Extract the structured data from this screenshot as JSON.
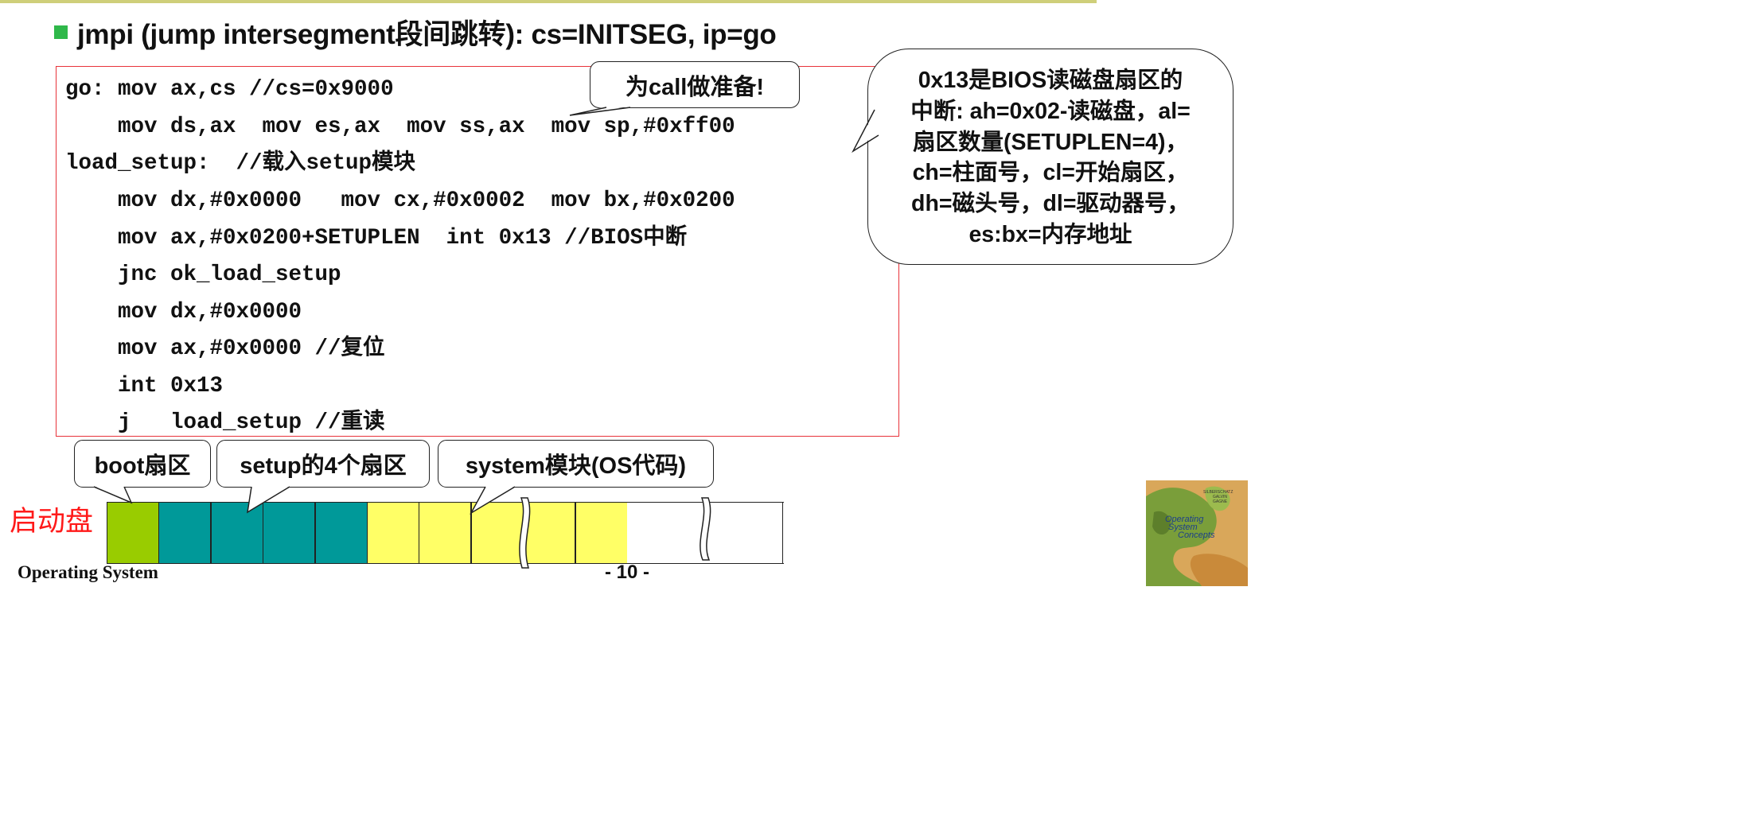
{
  "colors": {
    "accent_rule": "#cfcf7a",
    "bullet": "#2fb84a",
    "code_border": "#e8333a",
    "disk_label": "#ff1a1a",
    "boot_sector": "#99cc00",
    "setup_sector": "#009999",
    "system_sector": "#ffff66",
    "free_sector": "#ffffff"
  },
  "title": "jmpi (jump intersegment段间跳转): cs=INITSEG, ip=go",
  "code_lines": [
    "go: mov ax,cs //cs=0x9000",
    "    mov ds,ax  mov es,ax  mov ss,ax  mov sp,#0xff00",
    "load_setup:  //载入setup模块",
    "    mov dx,#0x0000   mov cx,#0x0002  mov bx,#0x0200",
    "    mov ax,#0x0200+SETUPLEN  int 0x13 //BIOS中断",
    "    jnc ok_load_setup",
    "    mov dx,#0x0000",
    "    mov ax,#0x0000 //复位",
    "    int 0x13",
    "    j   load_setup //重读"
  ],
  "callouts": {
    "call_prep": "为call做准备!",
    "bios_lines": [
      "0x13是BIOS读磁盘扇区的",
      "中断: ah=0x02-读磁盘，al=",
      "扇区数量(SETUPLEN=4)，",
      "ch=柱面号，cl=开始扇区，",
      "dh=磁头号，dl=驱动器号，",
      "es:bx=内存地址"
    ]
  },
  "disk": {
    "label": "启动盘",
    "boot_label": "boot扇区",
    "setup_label": "setup的4个扇区",
    "system_label": "system模块(OS代码)",
    "sector_types": [
      "boot",
      "setup",
      "setup",
      "setup",
      "setup",
      "system",
      "system",
      "system",
      "system",
      "system",
      "free",
      "free",
      "free"
    ]
  },
  "footer": {
    "left": "Operating System",
    "page": "- 10 -"
  },
  "logo": {
    "icon": "dinosaur-book-cover-icon",
    "lines": [
      "SILBERSCHATZ",
      "GALVIN",
      "GAGNE",
      "Operating",
      "System",
      "Concepts"
    ]
  }
}
